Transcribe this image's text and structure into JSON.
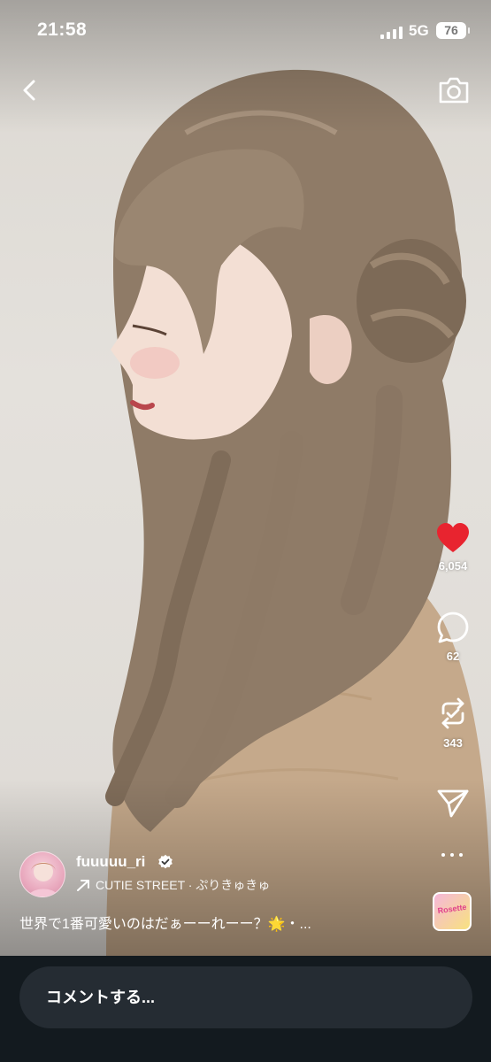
{
  "status_bar": {
    "time": "21:58",
    "network": "5G",
    "battery": "76"
  },
  "nav": {
    "back_icon": "chevron-left-icon",
    "camera_icon": "camera-icon"
  },
  "post": {
    "username": "fuuuuu_ri",
    "verified": true,
    "music": "CUTIE STREET · ぷりきゅきゅ",
    "caption": "世界で1番可愛いのはだぁーーれーー？🌟・...",
    "caption_text": "世界で1番可愛いのはだぁーーれーー？",
    "caption_sparkle": "🌟",
    "caption_tail": "・..."
  },
  "actions": {
    "like_count": "6,054",
    "comment_count": "62",
    "repost_count": "343",
    "like_color": "#e8242f"
  },
  "audio_thumbnail": {
    "label": "Rosette"
  },
  "comment_bar": {
    "placeholder": "コメントする..."
  }
}
